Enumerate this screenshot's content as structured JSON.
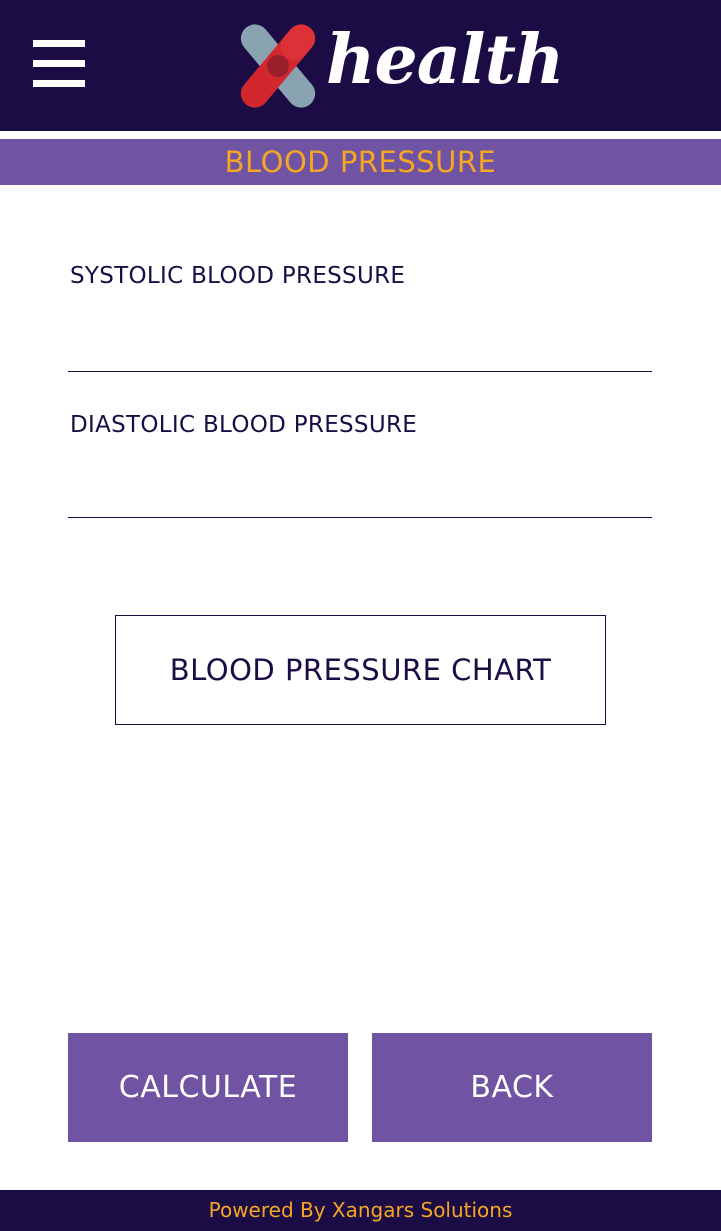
{
  "header": {
    "logo_text": "health",
    "menu_icon": "hamburger-menu-icon",
    "logo_icon": "x-cross-logo-icon"
  },
  "page": {
    "title": "BLOOD PRESSURE"
  },
  "form": {
    "systolic_label": "SYSTOLIC BLOOD PRESSURE",
    "systolic_value": "",
    "diastolic_label": "DIASTOLIC BLOOD PRESSURE",
    "diastolic_value": ""
  },
  "buttons": {
    "chart_label": "BLOOD PRESSURE CHART",
    "calculate_label": "CALCULATE",
    "back_label": "BACK"
  },
  "footer": {
    "text": "Powered By Xangars Solutions"
  },
  "colors": {
    "header_bg": "#1b0c45",
    "accent_purple": "#7053a2",
    "accent_orange": "#f5a623",
    "logo_red": "#d3272e",
    "logo_blue_grey": "#8aa3b0",
    "text_dark": "#1b0c45"
  }
}
